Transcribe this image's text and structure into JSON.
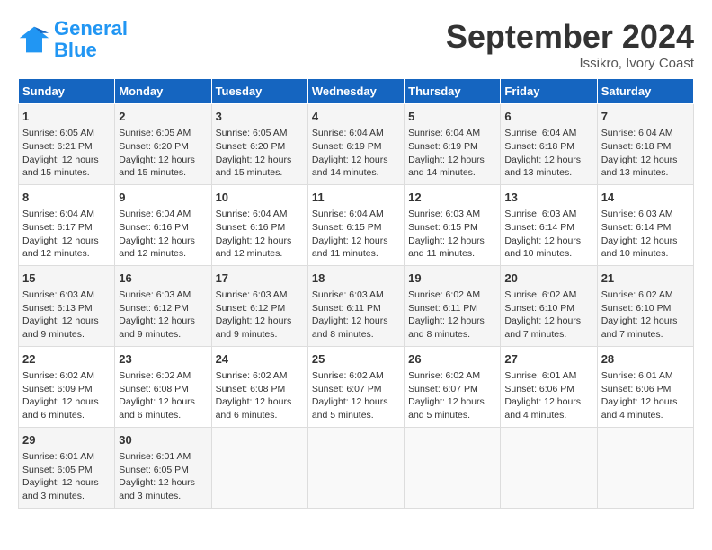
{
  "header": {
    "logo_general": "General",
    "logo_blue": "Blue",
    "month_year": "September 2024",
    "location": "Issikro, Ivory Coast"
  },
  "weekdays": [
    "Sunday",
    "Monday",
    "Tuesday",
    "Wednesday",
    "Thursday",
    "Friday",
    "Saturday"
  ],
  "weeks": [
    [
      {
        "day": "1",
        "sunrise": "Sunrise: 6:05 AM",
        "sunset": "Sunset: 6:21 PM",
        "daylight": "Daylight: 12 hours and 15 minutes."
      },
      {
        "day": "2",
        "sunrise": "Sunrise: 6:05 AM",
        "sunset": "Sunset: 6:20 PM",
        "daylight": "Daylight: 12 hours and 15 minutes."
      },
      {
        "day": "3",
        "sunrise": "Sunrise: 6:05 AM",
        "sunset": "Sunset: 6:20 PM",
        "daylight": "Daylight: 12 hours and 15 minutes."
      },
      {
        "day": "4",
        "sunrise": "Sunrise: 6:04 AM",
        "sunset": "Sunset: 6:19 PM",
        "daylight": "Daylight: 12 hours and 14 minutes."
      },
      {
        "day": "5",
        "sunrise": "Sunrise: 6:04 AM",
        "sunset": "Sunset: 6:19 PM",
        "daylight": "Daylight: 12 hours and 14 minutes."
      },
      {
        "day": "6",
        "sunrise": "Sunrise: 6:04 AM",
        "sunset": "Sunset: 6:18 PM",
        "daylight": "Daylight: 12 hours and 13 minutes."
      },
      {
        "day": "7",
        "sunrise": "Sunrise: 6:04 AM",
        "sunset": "Sunset: 6:18 PM",
        "daylight": "Daylight: 12 hours and 13 minutes."
      }
    ],
    [
      {
        "day": "8",
        "sunrise": "Sunrise: 6:04 AM",
        "sunset": "Sunset: 6:17 PM",
        "daylight": "Daylight: 12 hours and 12 minutes."
      },
      {
        "day": "9",
        "sunrise": "Sunrise: 6:04 AM",
        "sunset": "Sunset: 6:16 PM",
        "daylight": "Daylight: 12 hours and 12 minutes."
      },
      {
        "day": "10",
        "sunrise": "Sunrise: 6:04 AM",
        "sunset": "Sunset: 6:16 PM",
        "daylight": "Daylight: 12 hours and 12 minutes."
      },
      {
        "day": "11",
        "sunrise": "Sunrise: 6:04 AM",
        "sunset": "Sunset: 6:15 PM",
        "daylight": "Daylight: 12 hours and 11 minutes."
      },
      {
        "day": "12",
        "sunrise": "Sunrise: 6:03 AM",
        "sunset": "Sunset: 6:15 PM",
        "daylight": "Daylight: 12 hours and 11 minutes."
      },
      {
        "day": "13",
        "sunrise": "Sunrise: 6:03 AM",
        "sunset": "Sunset: 6:14 PM",
        "daylight": "Daylight: 12 hours and 10 minutes."
      },
      {
        "day": "14",
        "sunrise": "Sunrise: 6:03 AM",
        "sunset": "Sunset: 6:14 PM",
        "daylight": "Daylight: 12 hours and 10 minutes."
      }
    ],
    [
      {
        "day": "15",
        "sunrise": "Sunrise: 6:03 AM",
        "sunset": "Sunset: 6:13 PM",
        "daylight": "Daylight: 12 hours and 9 minutes."
      },
      {
        "day": "16",
        "sunrise": "Sunrise: 6:03 AM",
        "sunset": "Sunset: 6:12 PM",
        "daylight": "Daylight: 12 hours and 9 minutes."
      },
      {
        "day": "17",
        "sunrise": "Sunrise: 6:03 AM",
        "sunset": "Sunset: 6:12 PM",
        "daylight": "Daylight: 12 hours and 9 minutes."
      },
      {
        "day": "18",
        "sunrise": "Sunrise: 6:03 AM",
        "sunset": "Sunset: 6:11 PM",
        "daylight": "Daylight: 12 hours and 8 minutes."
      },
      {
        "day": "19",
        "sunrise": "Sunrise: 6:02 AM",
        "sunset": "Sunset: 6:11 PM",
        "daylight": "Daylight: 12 hours and 8 minutes."
      },
      {
        "day": "20",
        "sunrise": "Sunrise: 6:02 AM",
        "sunset": "Sunset: 6:10 PM",
        "daylight": "Daylight: 12 hours and 7 minutes."
      },
      {
        "day": "21",
        "sunrise": "Sunrise: 6:02 AM",
        "sunset": "Sunset: 6:10 PM",
        "daylight": "Daylight: 12 hours and 7 minutes."
      }
    ],
    [
      {
        "day": "22",
        "sunrise": "Sunrise: 6:02 AM",
        "sunset": "Sunset: 6:09 PM",
        "daylight": "Daylight: 12 hours and 6 minutes."
      },
      {
        "day": "23",
        "sunrise": "Sunrise: 6:02 AM",
        "sunset": "Sunset: 6:08 PM",
        "daylight": "Daylight: 12 hours and 6 minutes."
      },
      {
        "day": "24",
        "sunrise": "Sunrise: 6:02 AM",
        "sunset": "Sunset: 6:08 PM",
        "daylight": "Daylight: 12 hours and 6 minutes."
      },
      {
        "day": "25",
        "sunrise": "Sunrise: 6:02 AM",
        "sunset": "Sunset: 6:07 PM",
        "daylight": "Daylight: 12 hours and 5 minutes."
      },
      {
        "day": "26",
        "sunrise": "Sunrise: 6:02 AM",
        "sunset": "Sunset: 6:07 PM",
        "daylight": "Daylight: 12 hours and 5 minutes."
      },
      {
        "day": "27",
        "sunrise": "Sunrise: 6:01 AM",
        "sunset": "Sunset: 6:06 PM",
        "daylight": "Daylight: 12 hours and 4 minutes."
      },
      {
        "day": "28",
        "sunrise": "Sunrise: 6:01 AM",
        "sunset": "Sunset: 6:06 PM",
        "daylight": "Daylight: 12 hours and 4 minutes."
      }
    ],
    [
      {
        "day": "29",
        "sunrise": "Sunrise: 6:01 AM",
        "sunset": "Sunset: 6:05 PM",
        "daylight": "Daylight: 12 hours and 3 minutes."
      },
      {
        "day": "30",
        "sunrise": "Sunrise: 6:01 AM",
        "sunset": "Sunset: 6:05 PM",
        "daylight": "Daylight: 12 hours and 3 minutes."
      },
      null,
      null,
      null,
      null,
      null
    ]
  ]
}
